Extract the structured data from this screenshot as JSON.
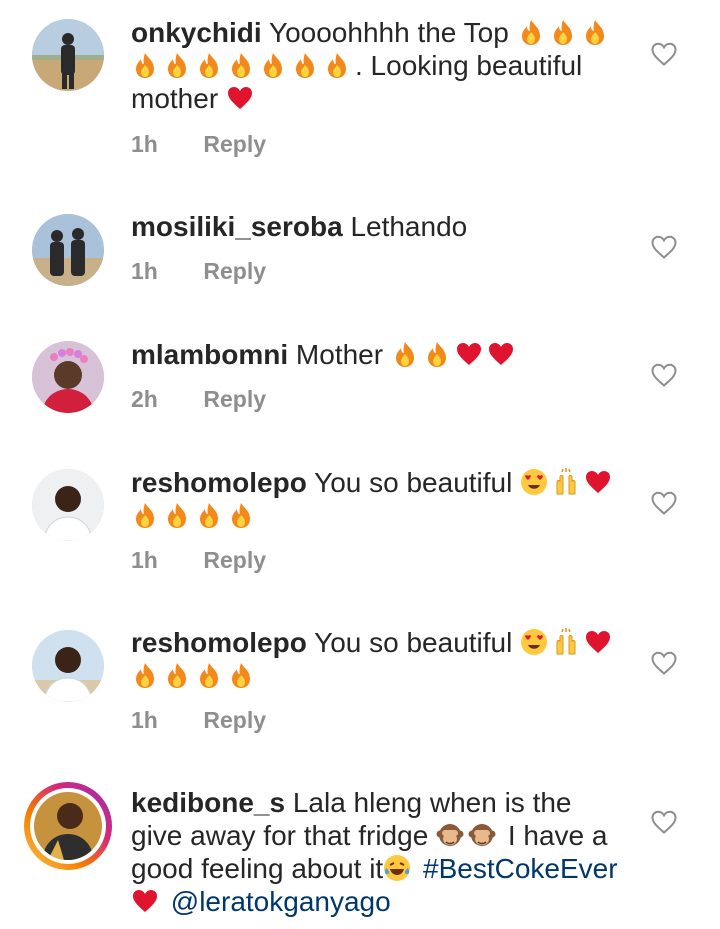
{
  "comments": [
    {
      "username": "onkychidi",
      "text_before": "Yoooohhhh the Top",
      "fire_row1": 3,
      "fire_row2": 7,
      "text_after": ". Looking beautiful mother",
      "time": "1h",
      "reply": "Reply"
    },
    {
      "username": "mosiliki_seroba",
      "text": "Lethando",
      "time": "1h",
      "reply": "Reply"
    },
    {
      "username": "mlambomni",
      "text": "Mother",
      "time": "2h",
      "reply": "Reply"
    },
    {
      "username": "reshomolepo",
      "text": "You so beautiful",
      "time": "1h",
      "reply": "Reply"
    },
    {
      "username": "reshomolepo",
      "text": "You so beautiful",
      "time": "1h",
      "reply": "Reply"
    },
    {
      "username": "kedibone_s",
      "text_part1": "Lala hleng when is the give away for that fridge",
      "text_part2": "I have a good feeling about it",
      "hashtag": "#BestCokeEver",
      "mention": "@leratokganyago"
    }
  ],
  "colors": {
    "text": "#262626",
    "meta": "#8e8e8e",
    "link": "#00376b",
    "fire": "#f2891b",
    "heart_red": "#e0142e"
  },
  "icons": [
    "fire-emoji-icon",
    "red-heart-emoji-icon",
    "heart-eyes-emoji-icon",
    "raising-hands-emoji-icon",
    "see-no-evil-monkey-emoji-icon",
    "tears-of-joy-emoji-icon",
    "heart-outline-icon"
  ]
}
